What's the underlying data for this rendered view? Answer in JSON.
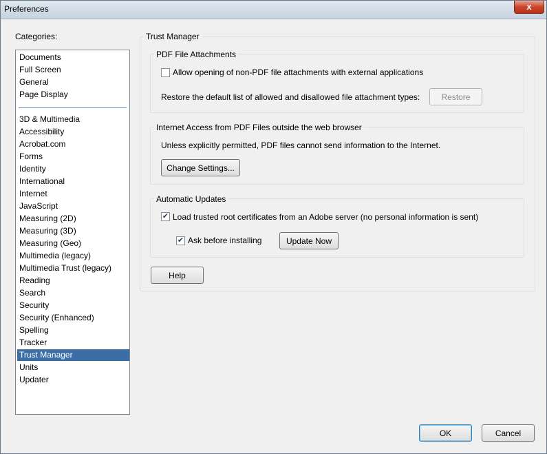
{
  "window": {
    "title": "Preferences",
    "close_label": "x"
  },
  "categories": {
    "label": "Categories:",
    "group1": [
      "Documents",
      "Full Screen",
      "General",
      "Page Display"
    ],
    "group2": [
      "3D & Multimedia",
      "Accessibility",
      "Acrobat.com",
      "Forms",
      "Identity",
      "International",
      "Internet",
      "JavaScript",
      "Measuring (2D)",
      "Measuring (3D)",
      "Measuring (Geo)",
      "Multimedia (legacy)",
      "Multimedia Trust (legacy)",
      "Reading",
      "Search",
      "Security",
      "Security (Enhanced)",
      "Spelling",
      "Tracker",
      "Trust Manager",
      "Units",
      "Updater"
    ],
    "selected": "Trust Manager"
  },
  "trust_manager": {
    "title": "Trust Manager",
    "pdf_attachments": {
      "title": "PDF File Attachments",
      "allow_checkbox_label": "Allow opening of non-PDF file attachments with external applications",
      "allow_checked": false,
      "restore_text": "Restore the default list of allowed and disallowed file attachment types:",
      "restore_button": "Restore"
    },
    "internet_access": {
      "title": "Internet Access from PDF Files outside the web browser",
      "info_text": "Unless explicitly permitted, PDF files cannot send information to the Internet.",
      "change_settings_button": "Change Settings..."
    },
    "automatic_updates": {
      "title": "Automatic Updates",
      "load_certs_label": "Load trusted root certificates from an Adobe server (no personal information is sent)",
      "load_certs_checked": true,
      "ask_before_label": "Ask before installing",
      "ask_before_checked": true,
      "update_now_button": "Update Now"
    },
    "help_button": "Help"
  },
  "footer": {
    "ok_button": "OK",
    "cancel_button": "Cancel"
  }
}
